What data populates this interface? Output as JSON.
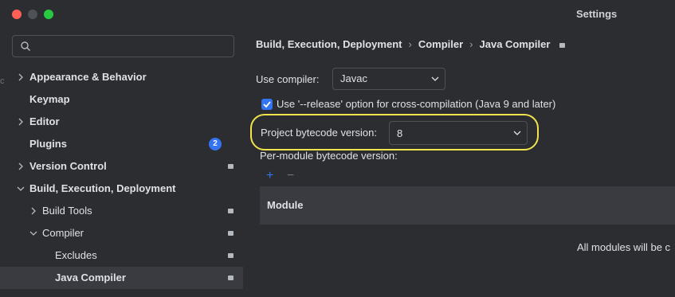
{
  "window": {
    "title": "Settings"
  },
  "search": {
    "placeholder": ""
  },
  "sidebar": {
    "edge_char": "c",
    "items": [
      {
        "label": "Appearance & Behavior"
      },
      {
        "label": "Keymap"
      },
      {
        "label": "Editor"
      },
      {
        "label": "Plugins",
        "badge": "2"
      },
      {
        "label": "Version Control"
      },
      {
        "label": "Build, Execution, Deployment"
      },
      {
        "label": "Build Tools"
      },
      {
        "label": "Compiler"
      },
      {
        "label": "Excludes"
      },
      {
        "label": "Java Compiler"
      }
    ]
  },
  "breadcrumb": [
    "Build, Execution, Deployment",
    "Compiler",
    "Java Compiler"
  ],
  "compiler": {
    "use_compiler_label": "Use compiler:",
    "use_compiler_value": "Javac",
    "release_option_label": "Use '--release' option for cross-compilation (Java 9 and later)",
    "release_option_checked": true,
    "bytecode_label": "Project bytecode version:",
    "bytecode_value": "8",
    "per_module_label": "Per-module bytecode version:",
    "add_symbol": "+",
    "remove_symbol": "−",
    "table_header": "Module",
    "empty_text": "All modules will be c"
  },
  "colors": {
    "accent": "#3574f0",
    "highlight": "#f1e34b",
    "background": "#2b2d30",
    "selected": "#393b40"
  }
}
